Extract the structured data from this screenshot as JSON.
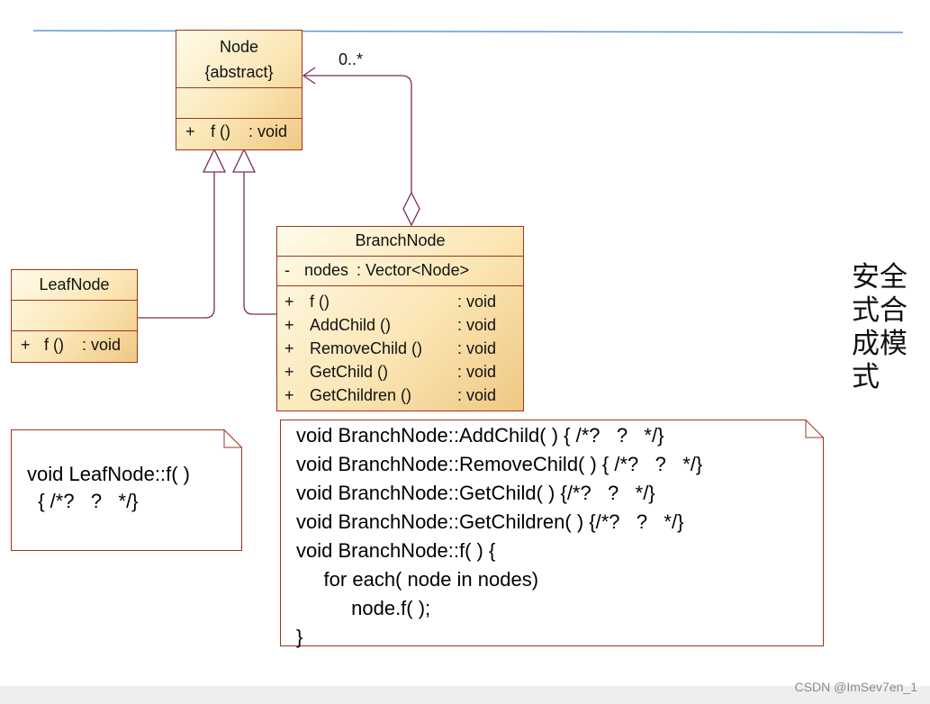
{
  "classes": {
    "node": {
      "name": "Node",
      "stereotype": "{abstract}",
      "operations": [
        {
          "vis": "+",
          "name": "f ()",
          "type": ": void"
        }
      ]
    },
    "branch": {
      "name": "BranchNode",
      "attributes": [
        {
          "vis": "-",
          "name": "nodes",
          "type": ": Vector<Node>"
        }
      ],
      "operations": [
        {
          "vis": "+",
          "name": "f ()",
          "type": ": void"
        },
        {
          "vis": "+",
          "name": "AddChild ()",
          "type": ": void"
        },
        {
          "vis": "+",
          "name": "RemoveChild ()",
          "type": ": void"
        },
        {
          "vis": "+",
          "name": "GetChild ()",
          "type": ": void"
        },
        {
          "vis": "+",
          "name": "GetChildren ()",
          "type": ": void"
        }
      ]
    },
    "leaf": {
      "name": "LeafNode",
      "operations": [
        {
          "vis": "+",
          "name": "f ()",
          "type": ": void"
        }
      ]
    }
  },
  "multiplicity": "0..*",
  "notes": {
    "leaf": [
      "void LeafNode::f( )",
      "  { /*?   ?   */}"
    ],
    "branch": [
      "void BranchNode::AddChild( ) { /*?   ?   */}",
      "void BranchNode::RemoveChild( ) { /*?   ?   */}",
      "void BranchNode::GetChild( ) {/*?   ?   */}",
      "void BranchNode::GetChildren( ) {/*?   ?   */}",
      "void BranchNode::f( ) {",
      "     for each( node in nodes)",
      "          node.f( );",
      "}"
    ]
  },
  "side_title": "安全式合成模式",
  "watermark": "CSDN @ImSev7en_1",
  "colors": {
    "class_border": "#a0341b",
    "connector": "#7b2a5c",
    "top_rule": "#5b9bd5"
  }
}
